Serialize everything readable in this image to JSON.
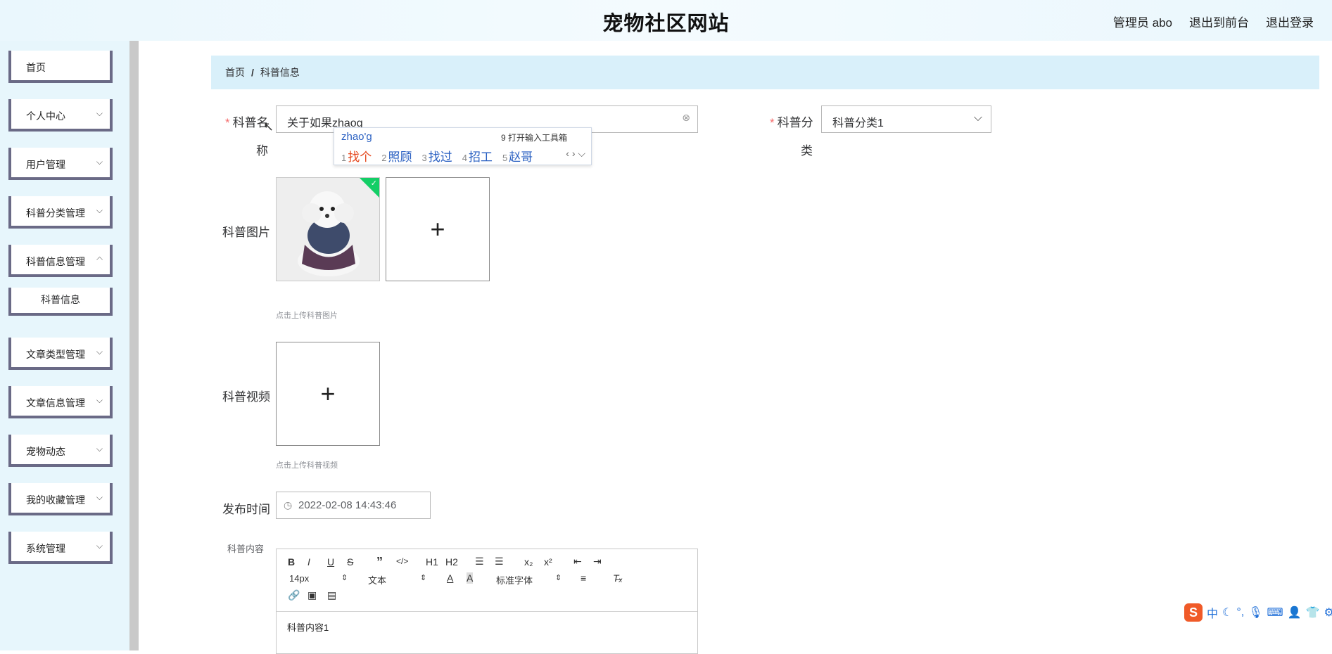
{
  "header": {
    "title": "宠物社区网站",
    "admin": "管理员 abo",
    "to_front": "退出到前台",
    "logout": "退出登录"
  },
  "sidebar": {
    "items": [
      {
        "label": "首页",
        "has_children": false
      },
      {
        "label": "个人中心",
        "has_children": true
      },
      {
        "label": "用户管理",
        "has_children": true
      },
      {
        "label": "科普分类管理",
        "has_children": true
      },
      {
        "label": "科普信息管理",
        "has_children": true
      },
      {
        "label": "科普信息",
        "sub": true
      },
      {
        "label": "文章类型管理",
        "has_children": true
      },
      {
        "label": "文章信息管理",
        "has_children": true
      },
      {
        "label": "宠物动态",
        "has_children": true
      },
      {
        "label": "我的收藏管理",
        "has_children": true
      },
      {
        "label": "系统管理",
        "has_children": true
      }
    ]
  },
  "breadcrumb": [
    "首页",
    "科普信息"
  ],
  "form": {
    "name_label_a": "科普名",
    "name_label_b": "称",
    "name_value": "关于如果zhaog",
    "category_label_a": "科普分",
    "category_label_b": "类",
    "category_value": "科普分类1",
    "image_label": "科普图片",
    "image_hint": "点击上传科普图片",
    "video_label": "科普视频",
    "video_hint": "点击上传科普视频",
    "time_label": "发布时间",
    "time_value": "2022-02-08 14:43:46",
    "content_label": "科普内容",
    "content_value": "科普内容1"
  },
  "ime": {
    "composition": "zhao'g",
    "toolbox": "9 打开输入工具箱",
    "candidates": [
      {
        "n": "1",
        "text": "找个"
      },
      {
        "n": "2",
        "text": "照顾"
      },
      {
        "n": "3",
        "text": "找过"
      },
      {
        "n": "4",
        "text": "招工"
      },
      {
        "n": "5",
        "text": "赵哥"
      }
    ]
  },
  "editor": {
    "font_size": "14px",
    "paragraph": "文本",
    "font_family": "标准字体",
    "h1": "H1",
    "h2": "H2"
  },
  "sogou": {
    "logo": "S",
    "mode": "中"
  },
  "colors": {
    "accent_bg": "#d9f0fa",
    "sidebar_border": "#6a6a86",
    "required": "#f56c6c",
    "ime_first": "#e5461c",
    "ime_candidate": "#2a60c2"
  }
}
